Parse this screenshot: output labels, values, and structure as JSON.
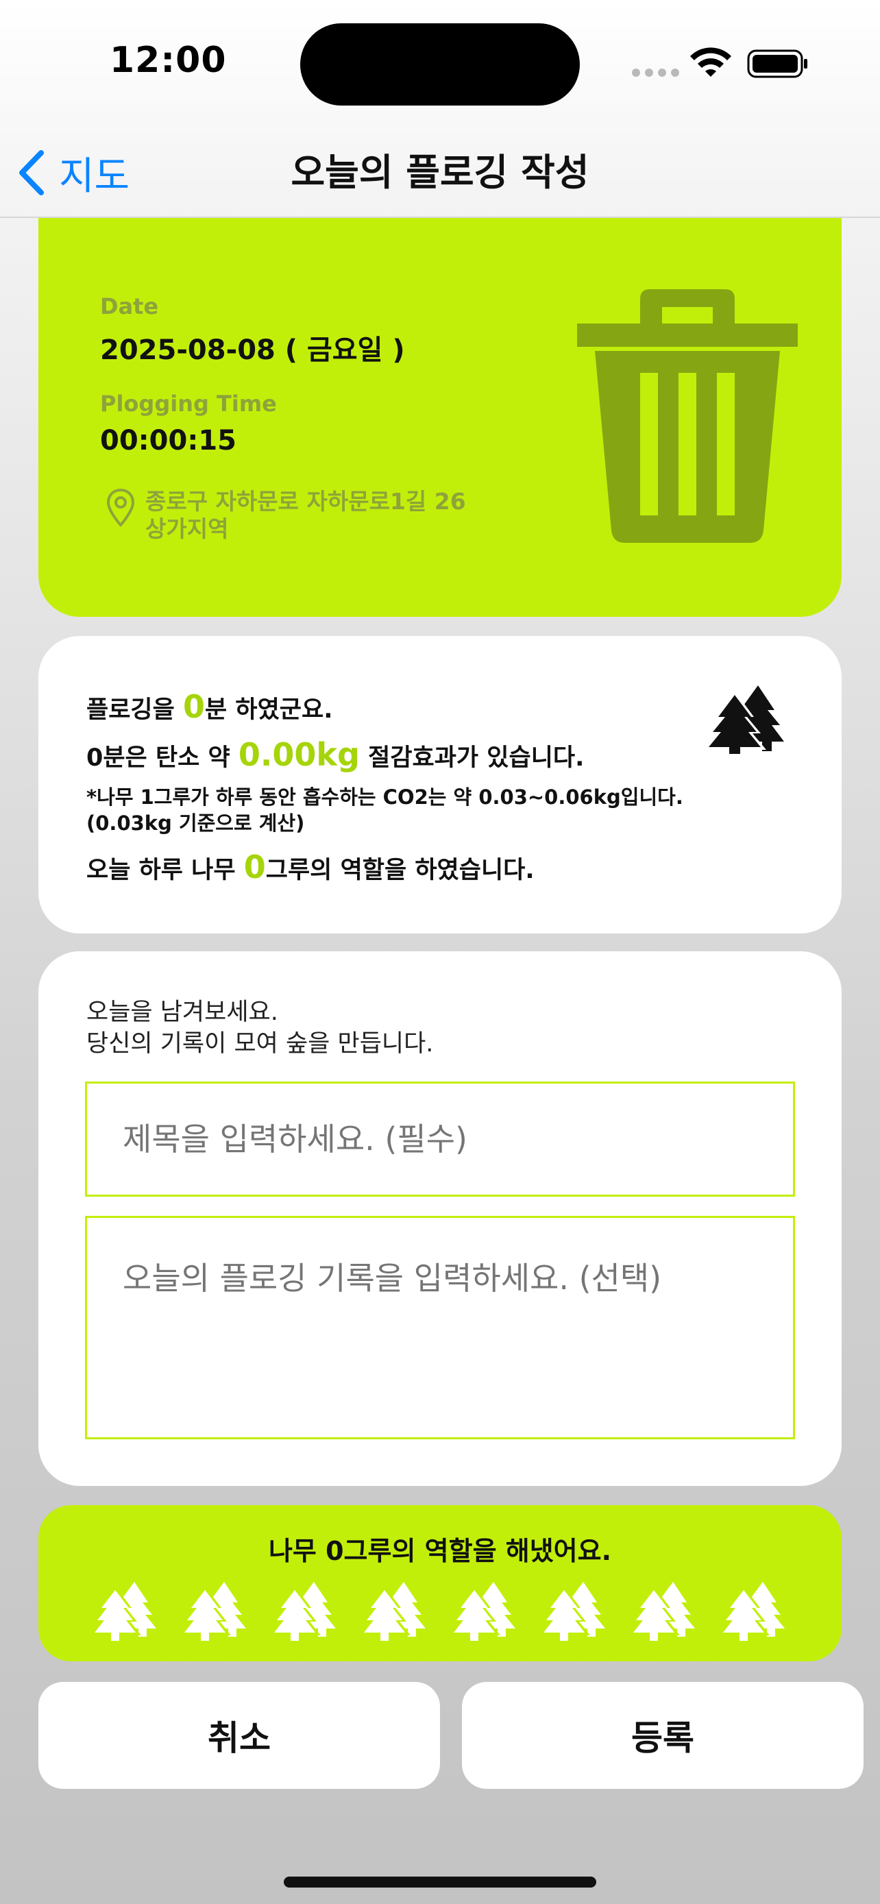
{
  "status_bar": {
    "time": "12:00"
  },
  "nav": {
    "back_label": "지도",
    "title": "오늘의 플로깅 작성"
  },
  "info_card": {
    "date_label": "Date",
    "date_value": "2025-08-08 ( 금요일 )",
    "time_label": "Plogging Time",
    "time_value": "00:00:15",
    "address_line1": "종로구 자하문로 자하문로1길 26",
    "address_line2": "상가지역",
    "icon": "trash-can-icon"
  },
  "carbon_card": {
    "line1_pre": "플로깅을 ",
    "line1_value": "0",
    "line1_post": "분 하였군요.",
    "line2_pre": "0분은 탄소 약 ",
    "line2_value": "0.00kg",
    "line2_post": " 절감효과가 있습니다.",
    "note_line1": "*나무 1그루가 하루 동안 흡수하는 CO2는 약 0.03~0.06kg입니다.",
    "note_line2": "(0.03kg 기준으로 계산)",
    "line3_pre": "오늘 하루 나무 ",
    "line3_value": "0",
    "line3_post": "그루의 역할을 하였습니다.",
    "icon": "trees-icon"
  },
  "memo_card": {
    "intro_line1": "오늘을 남겨보세요.",
    "intro_line2": "당신의 기록이 모여 숲을 만듭니다.",
    "title_placeholder": "제목을 입력하세요. (필수)",
    "body_placeholder": "오늘의 플로깅 기록을 입력하세요. (선택)"
  },
  "tree_card": {
    "title_pre": "나무 ",
    "title_value": "0",
    "title_post": "그루의 역할을 해냈어요.",
    "tree_count": 8
  },
  "buttons": {
    "cancel": "취소",
    "submit": "등록"
  },
  "colors": {
    "accent": "#c2ef0a",
    "accent_text": "#a6d40a",
    "link": "#0a84ff"
  }
}
